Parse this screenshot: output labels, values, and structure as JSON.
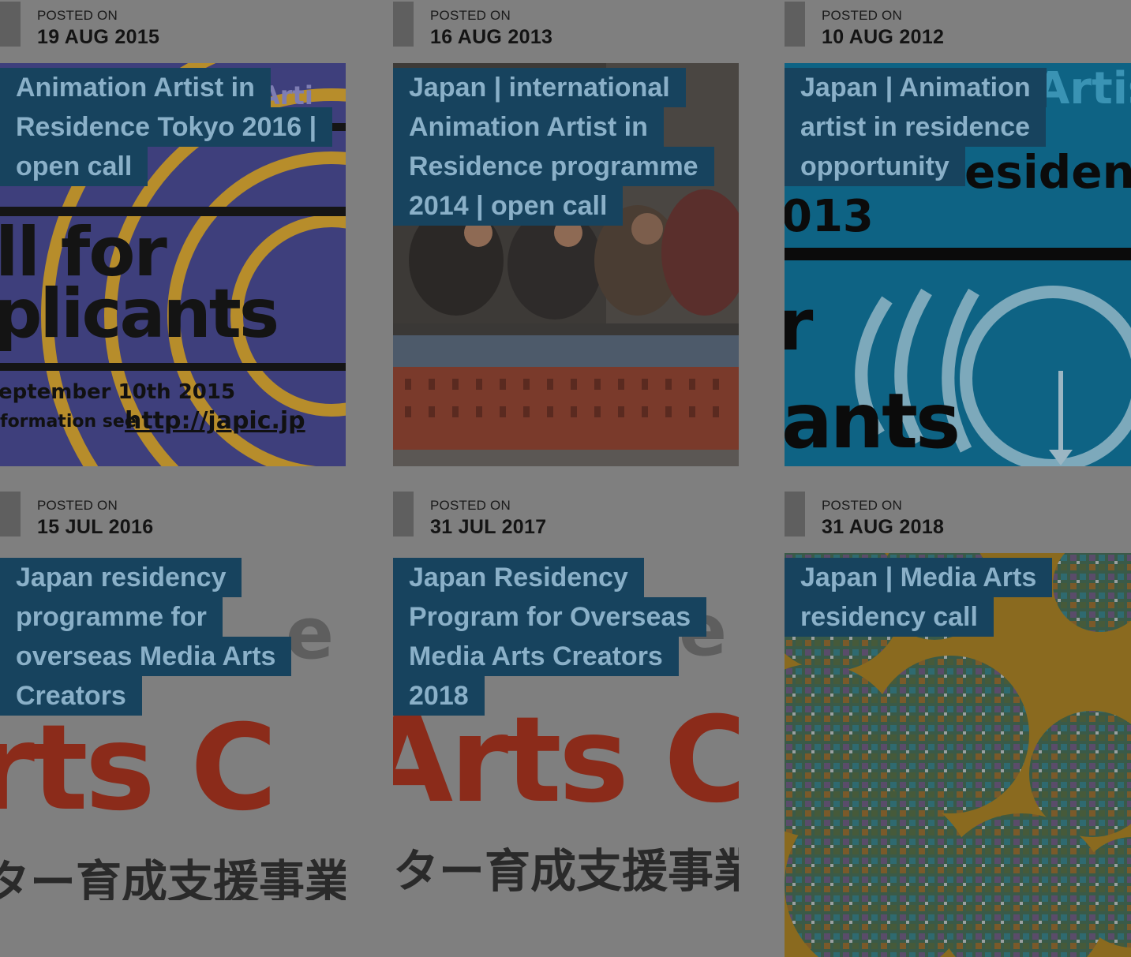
{
  "posted_label": "POSTED ON",
  "posts": [
    {
      "date": "19 AUG 2015",
      "title_lines": [
        "Animation Artist in",
        "Residence Tokyo 2016 |",
        "open call"
      ],
      "image": {
        "big": "ll for",
        "big2": "plicants",
        "line1": "eptember 10th 2015",
        "line2": "formation see",
        "url": "http://japic.jp",
        "top": "Arti"
      }
    },
    {
      "date": "16 AUG 2013",
      "title_lines": [
        "Japan | international",
        "Animation Artist in",
        "Residence programme",
        "2014 | open call"
      ]
    },
    {
      "date": "10 AUG 2012",
      "title_lines": [
        "Japan | Animation",
        "artist in residence",
        "opportunity"
      ],
      "image": {
        "top": "Artis",
        "mid": "esidenc",
        "year": "013",
        "big": "r",
        "big2": "ants"
      }
    },
    {
      "date": "15 JUL 2016",
      "title_lines": [
        "Japan residency",
        "programme for",
        "overseas Media Arts",
        "Creators"
      ],
      "image": {
        "big": "rts C",
        "jp": "ター育成支援事業",
        "fragment": "e"
      }
    },
    {
      "date": "31 JUL 2017",
      "title_lines": [
        "Japan Residency",
        "Program for Overseas",
        "Media Arts Creators",
        "2018"
      ],
      "image": {
        "big": "Arts C",
        "jp": "ター育成支援事業",
        "fragment": "e"
      }
    },
    {
      "date": "31 AUG 2018",
      "title_lines": [
        "Japan | Media Arts",
        "residency call"
      ]
    }
  ]
}
